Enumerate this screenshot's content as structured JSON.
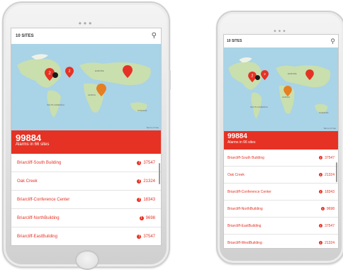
{
  "header": {
    "sites_label": "10 SITES"
  },
  "map": {
    "labels": [
      "EUROPE",
      "AFRICA",
      "SOUTH AMERICA",
      "OCEANIA"
    ],
    "terms": "Terms of Use"
  },
  "summary": {
    "count": "99884",
    "subtitle": "Alarms in 66 sites"
  },
  "sites": [
    {
      "name": "Briarcliff-South Building",
      "alarms": "37547"
    },
    {
      "name": "Oak Creek",
      "alarms": "21324"
    },
    {
      "name": "Briarcliff-Conference Center",
      "alarms": "18343"
    },
    {
      "name": "Briarcliff-NorthBuilding",
      "alarms": "9698"
    },
    {
      "name": "Briarcliff-EastBuilding",
      "alarms": "37547"
    },
    {
      "name": "Briarcliff-WestBuilding",
      "alarms": "21324"
    }
  ],
  "colors": {
    "accent": "#e53224",
    "ocean": "#a9d3e6",
    "land": "#c9dfae",
    "marker_orange": "#e67e22"
  }
}
